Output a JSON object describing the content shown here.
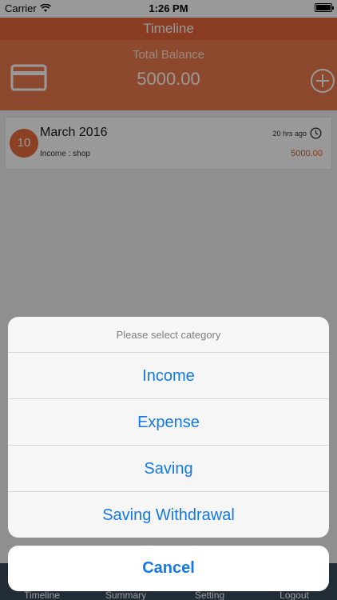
{
  "status_bar": {
    "carrier": "Carrier",
    "time": "1:26 PM"
  },
  "nav": {
    "title": "Timeline"
  },
  "balance": {
    "label": "Total Balance",
    "value": "5000.00"
  },
  "timeline_item": {
    "day": "10",
    "title": "March 2016",
    "subtitle": "Income : shop",
    "time_ago": "20 hrs ago",
    "amount": "5000.00"
  },
  "tabs": [
    "Timeline",
    "Summary",
    "Setting",
    "Logout"
  ],
  "action_sheet": {
    "title": "Please select category",
    "options": [
      "Income",
      "Expense",
      "Saving",
      "Saving Withdrawal"
    ],
    "cancel": "Cancel"
  },
  "colors": {
    "nav": "#e4643a",
    "header": "#ec7a4d",
    "accent_blue": "#1479e6",
    "amount": "#e05a24",
    "tab_bar": "#3a4a5c"
  }
}
